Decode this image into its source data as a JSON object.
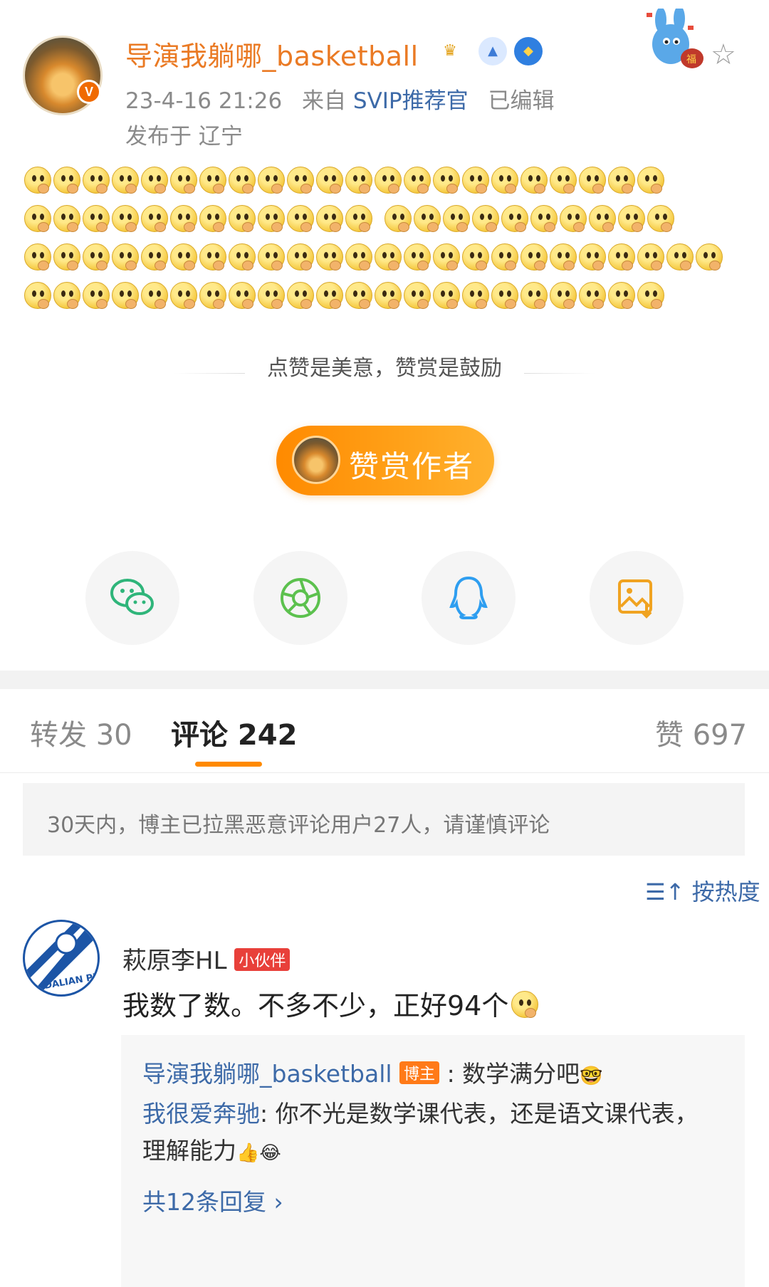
{
  "post": {
    "username": "导演我躺哪_basketball",
    "timestamp": "23-4-16 21:26",
    "source_prefix": "来自",
    "source": "SVIP推荐官",
    "edited": "已编辑",
    "location": "发布于 辽宁",
    "avatar_badge": "V"
  },
  "content": {
    "emoji_rows": [
      22,
      22,
      24,
      22
    ],
    "emoji_name": "thinking-face"
  },
  "reward": {
    "prompt": "点赞是美意，赞赏是鼓励",
    "button_label": "赞赏作者"
  },
  "share": [
    "wechat-icon",
    "moments-icon",
    "qq-icon",
    "save-image-icon"
  ],
  "tabs": {
    "repost": "转发 30",
    "comments": "评论 242",
    "likes": "赞 697"
  },
  "notice": "30天内，博主已拉黑恶意评论用户27人，请谨慎评论",
  "sort_label": "按热度",
  "comment": {
    "author": "萩原李HL",
    "author_tag": "小伙伴",
    "text": "我数了数。不多不少，正好94个",
    "replies": [
      {
        "name": "导演我躺哪_basketball",
        "tag": "博主",
        "text": ": 数学满分吧"
      },
      {
        "name": "我很爱奔驰",
        "text": ": 你不光是数学课代表，还是语文课代表，"
      },
      {
        "name": "",
        "text": "理解能力"
      }
    ],
    "more_replies": "共12条回复 ›"
  },
  "colors": {
    "accent": "#ff8a00",
    "link": "#3d6aa8",
    "username": "#ea7a24"
  }
}
